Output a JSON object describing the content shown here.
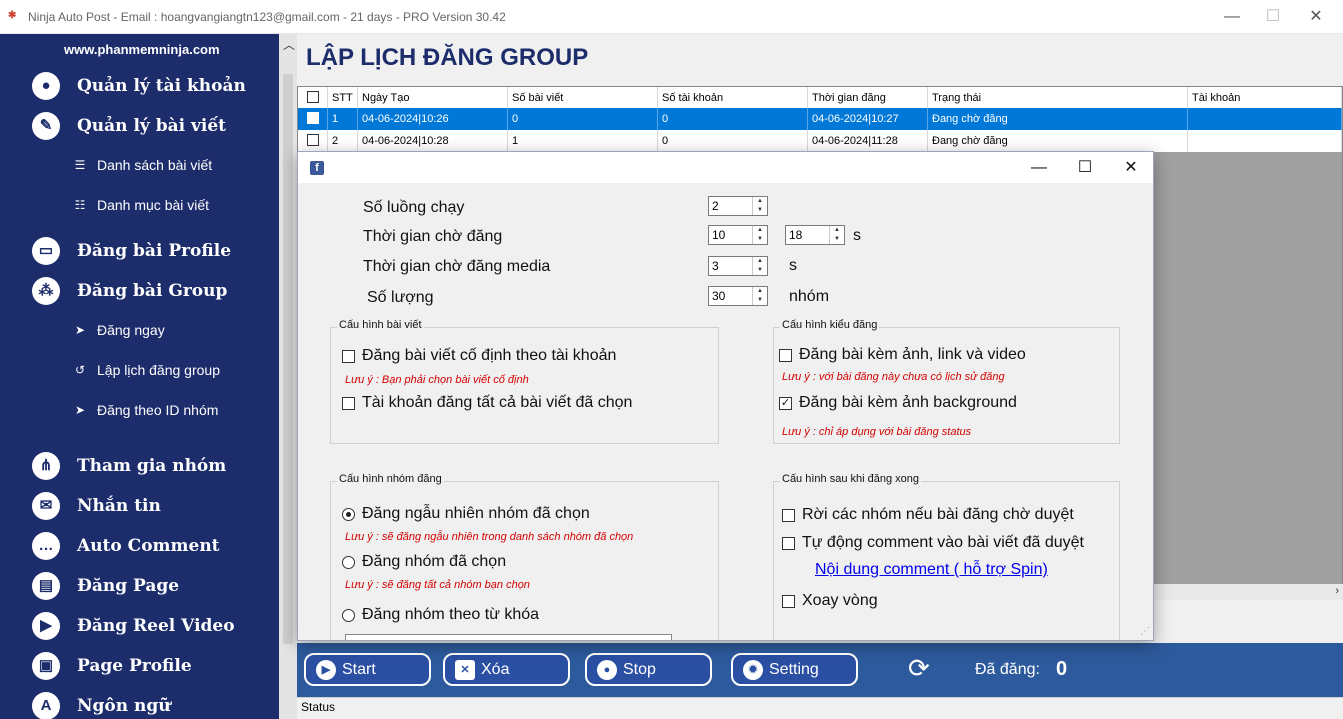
{
  "window": {
    "title": "Ninja Auto Post - Email : hoangvangiangtn123@gmail.com - 21 days -  PRO Version 30.42",
    "minimize": "—",
    "maximize": "☐",
    "close": "✕"
  },
  "sidebar": {
    "website": "www.phanmemninja.com",
    "items": [
      {
        "label": "Quản lý tài khoản",
        "icon": "user-icon"
      },
      {
        "label": "Quản lý bài viết",
        "icon": "pencil-icon"
      },
      {
        "label": "Danh sách bài viết",
        "icon": "list-icon"
      },
      {
        "label": "Danh mục bài viết",
        "icon": "list-check-icon"
      },
      {
        "label": "Đăng bài Profile",
        "icon": "monitor-icon"
      },
      {
        "label": "Đăng bài Group",
        "icon": "group-icon"
      },
      {
        "label": "Đăng ngay",
        "icon": "send-icon"
      },
      {
        "label": "Lập lịch đăng group",
        "icon": "history-icon"
      },
      {
        "label": "Đăng theo ID nhóm",
        "icon": "send-icon"
      },
      {
        "label": "Tham gia nhóm",
        "icon": "network-icon"
      },
      {
        "label": "Nhắn tin",
        "icon": "chat-icon"
      },
      {
        "label": "Auto Comment",
        "icon": "comment-icon"
      },
      {
        "label": "Đăng Page",
        "icon": "document-icon"
      },
      {
        "label": "Đăng Reel Video",
        "icon": "clapper-icon"
      },
      {
        "label": "Page Profile",
        "icon": "page-user-icon"
      },
      {
        "label": "Ngôn ngữ",
        "icon": "language-icon"
      }
    ]
  },
  "page": {
    "title": "LẬP LỊCH ĐĂNG GROUP"
  },
  "table": {
    "columns": [
      "STT",
      "Ngày Tạo",
      "Số bài viết",
      "Số tài khoản",
      "Thời gian đăng",
      "Trạng thái",
      "Tài khoản"
    ],
    "rows": [
      {
        "stt": "1",
        "created": "04-06-2024|10:26",
        "posts": "0",
        "accounts": "0",
        "time": "04-06-2024|10:27",
        "status": "Đang chờ đăng",
        "account": "",
        "selected": true
      },
      {
        "stt": "2",
        "created": "04-06-2024|10:28",
        "posts": "1",
        "accounts": "0",
        "time": "04-06-2024|11:28",
        "status": "Đang chờ đăng",
        "account": "",
        "selected": false
      }
    ]
  },
  "dialog": {
    "icon_letter": "f",
    "minimize": "—",
    "maximize": "☐",
    "close": "✕",
    "threads_label": "Số luồng chạy",
    "threads_value": "2",
    "wait_label": "Thời gian chờ đăng",
    "wait_min": "10",
    "wait_max": "18",
    "wait_unit": "s",
    "media_wait_label": "Thời gian chờ đăng media",
    "media_wait_value": "3",
    "media_wait_unit": "s",
    "quantity_label": "Số lượng",
    "quantity_value": "30",
    "quantity_unit": "nhóm",
    "post_config": {
      "title": "Cấu hình bài viết",
      "opt1": "Đăng bài viết cố định theo tài khoản",
      "note1": "Lưu ý : Bạn phải chọn bài viết cố định",
      "opt2": "Tài khoản đăng tất cả bài viết đã chọn"
    },
    "type_config": {
      "title": "Cấu hình kiểu đăng",
      "opt1": "Đăng bài kèm ảnh, link và video",
      "note1": "Lưu ý : với bài đăng này chưa có lịch sử đăng",
      "opt2": "Đăng bài kèm ảnh background",
      "opt2_checked": true,
      "note2": "Lưu ý : chỉ áp dụng với bài đăng status"
    },
    "group_config": {
      "title": "Cấu hình nhóm đăng",
      "opt1": "Đăng ngẫu nhiên nhóm đã chọn",
      "note1": "Lưu ý : sẽ đăng ngẫu nhiên trong danh sách nhóm đã chọn",
      "opt2": "Đăng nhóm đã chọn",
      "note2": "Lưu ý : sẽ đăng tất cả nhóm bạn chọn",
      "opt3": "Đăng nhóm theo từ khóa",
      "selected": "opt1"
    },
    "after_config": {
      "title": "Cấu hình sau khi đăng xong",
      "opt1": "Rời các nhóm nếu bài đăng chờ duyệt",
      "opt2": "Tự động comment vào bài viết đã duyệt",
      "link": "Nội dung comment ( hỗ trợ Spin)",
      "opt3": "Xoay vòng"
    }
  },
  "toolbar": {
    "start": "Start",
    "delete": "Xóa",
    "stop": "Stop",
    "setting": "Setting",
    "posted_label": "Đã đăng:",
    "posted_count": "0"
  },
  "status": {
    "text": "Status"
  }
}
